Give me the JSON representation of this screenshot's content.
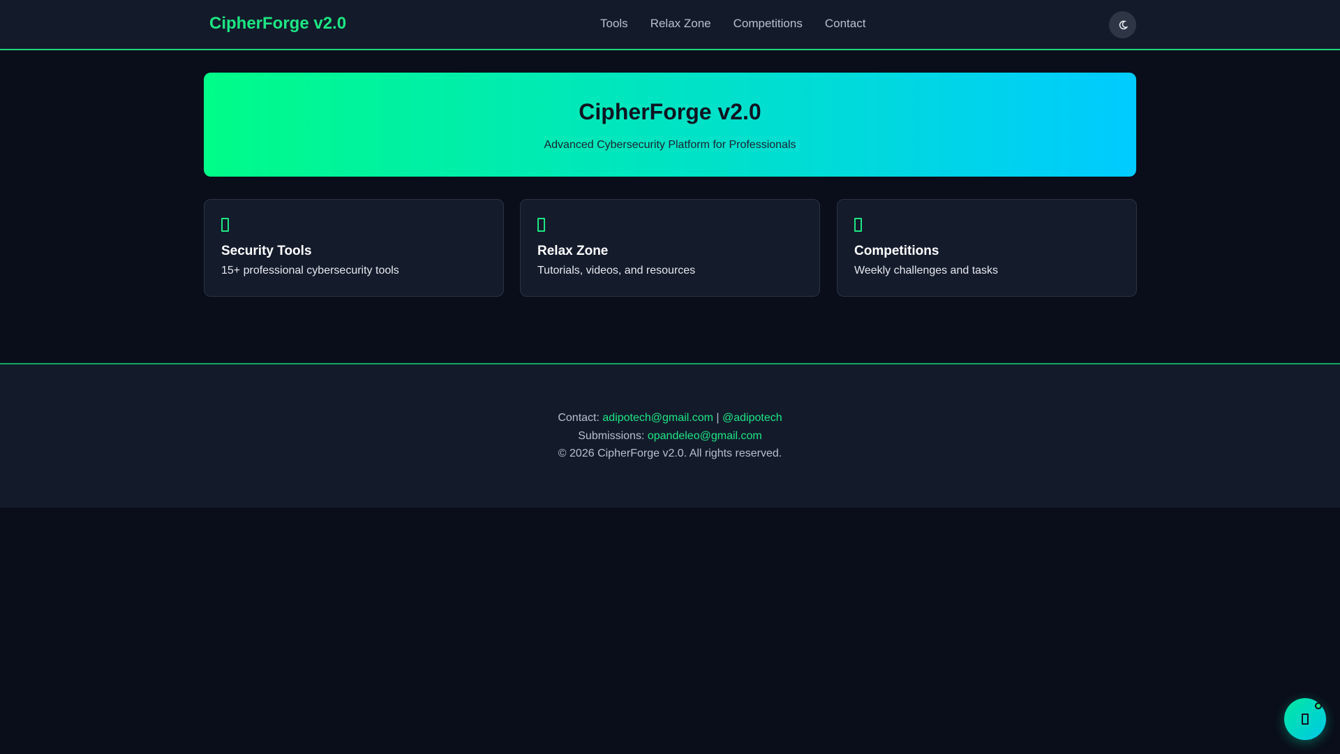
{
  "navbar": {
    "brand": "CipherForge v2.0",
    "links": [
      "Tools",
      "Relax Zone",
      "Competitions",
      "Contact"
    ],
    "theme_toggle_icon": "moon-icon"
  },
  "hero": {
    "title": "CipherForge v2.0",
    "subtitle": "Advanced Cybersecurity Platform for Professionals"
  },
  "cards": [
    {
      "icon": "shield-icon",
      "title": "Security Tools",
      "description": "15+ professional cybersecurity tools"
    },
    {
      "icon": "book-icon",
      "title": "Relax Zone",
      "description": "Tutorials, videos, and resources"
    },
    {
      "icon": "trophy-icon",
      "title": "Competitions",
      "description": "Weekly challenges and tasks"
    }
  ],
  "footer": {
    "contact_label": "Contact:",
    "contact_email": "adipotech@gmail.com",
    "separator": "|",
    "contact_handle": "@adipotech",
    "submissions_label": "Submissions:",
    "submissions_email": "opandeleo@gmail.com",
    "copyright": "© 2026 CipherForge v2.0. All rights reserved."
  },
  "chat": {
    "icon": "chat-icon"
  },
  "colors": {
    "accent": "#1de783",
    "background": "#0a0e1a",
    "surface": "#131b2b",
    "hero_gradient_start": "#00fc88",
    "hero_gradient_end": "#00cbff"
  }
}
